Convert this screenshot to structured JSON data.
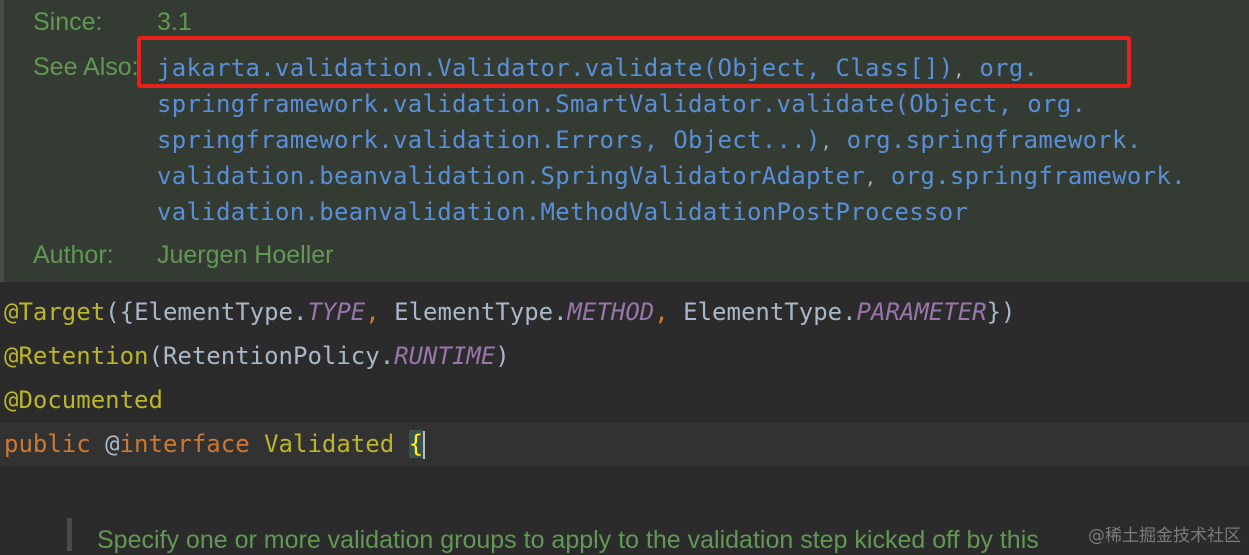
{
  "doc": {
    "since_label": "Since:",
    "since_value": "3.1",
    "see_also_label": "See Also:",
    "see_also_lines": [
      {
        "a": "jakarta.validation.Validator.validate(Object, Class[])",
        "sep": ",",
        "b": "org."
      },
      {
        "a": "springframework.validation.SmartValidator.validate(Object, org."
      },
      {
        "a": "springframework.validation.Errors, Object...)",
        "sep": ",",
        "b": "org.springframework."
      },
      {
        "a": "validation.beanvalidation.SpringValidatorAdapter",
        "sep": ",",
        "b": "org.springframework."
      },
      {
        "a": "validation.beanvalidation.MethodValidationPostProcessor"
      }
    ],
    "author_label": "Author:",
    "author_value": "Juergen Hoeller"
  },
  "code": {
    "line1": {
      "ann": "@Target",
      "open": "({",
      "t1": "ElementType.",
      "c1": "TYPE",
      "comma1": ", ",
      "t2": "ElementType.",
      "c2": "METHOD",
      "comma2": ", ",
      "t3": "ElementType.",
      "c3": "PARAMETER",
      "close": "})"
    },
    "line2": {
      "ann": "@Retention",
      "open": "(",
      "t1": "RetentionPolicy.",
      "c1": "RUNTIME",
      "close": ")"
    },
    "line3": {
      "ann": "@Documented"
    },
    "line4": {
      "kw": "public",
      "at": "@",
      "iface": "interface",
      "name": "Validated",
      "brace": "{"
    }
  },
  "bottom_doc_text": "Specify one or more validation groups to apply to the validation step kicked off by this",
  "watermark": "@稀土掘金技术社区",
  "colors": {
    "highlight_box": "#e8201c",
    "doc_green": "#629755",
    "link_blue": "#5a8fd6"
  }
}
